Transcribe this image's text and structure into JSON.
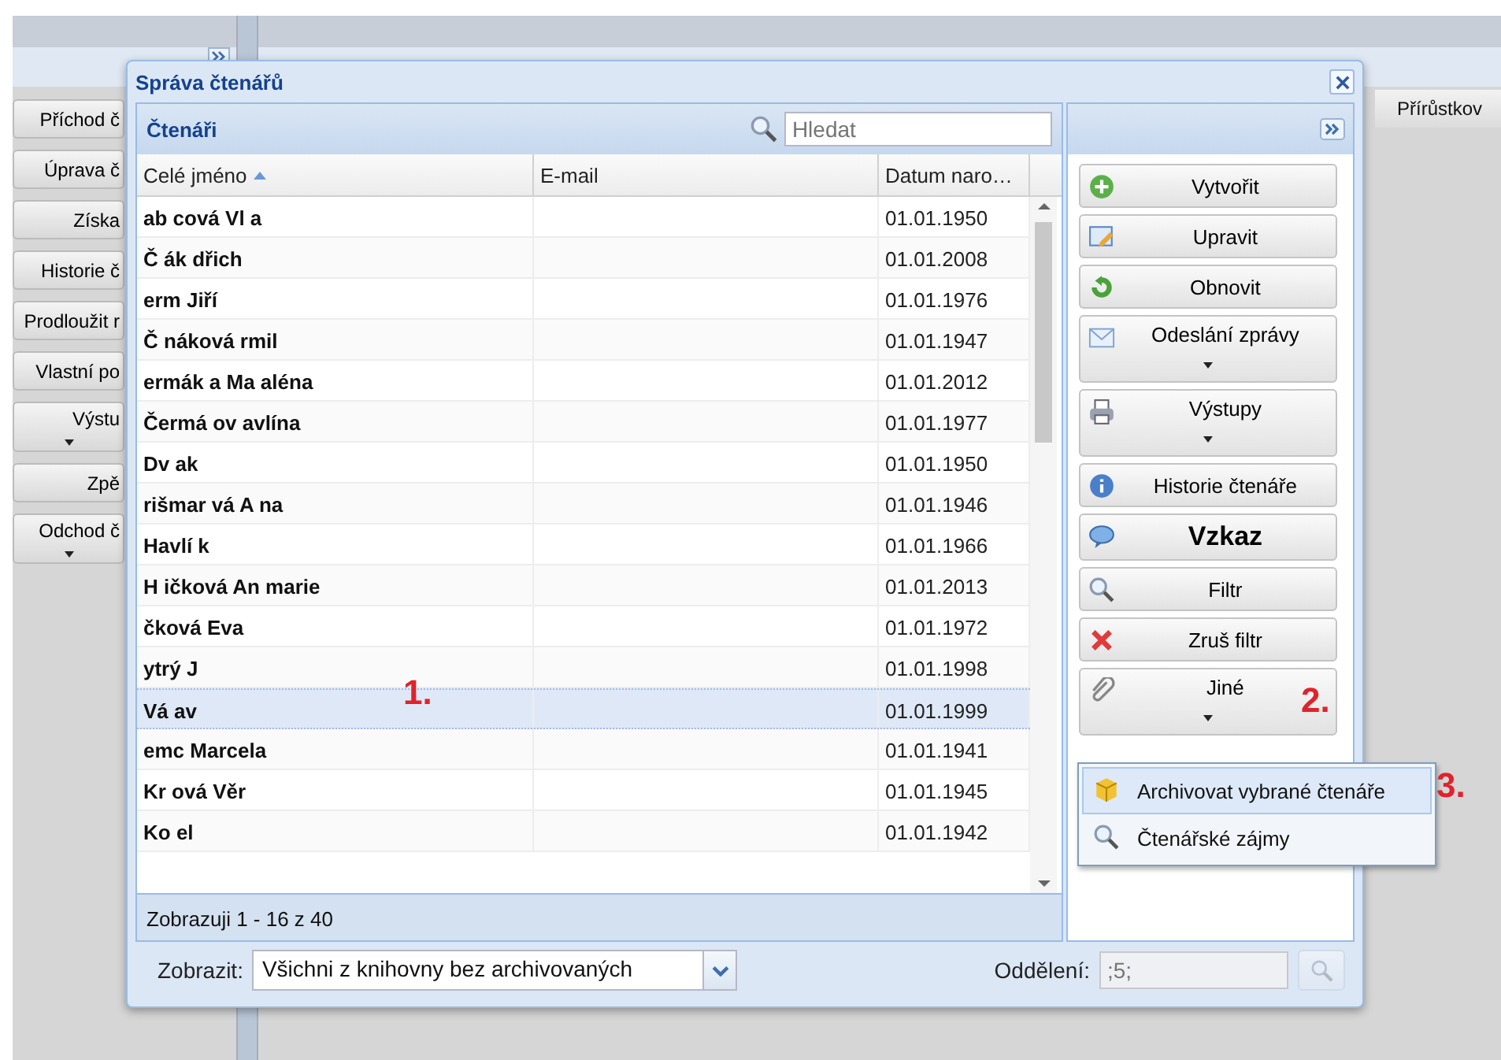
{
  "app": {
    "right_header": "Přírůstkov",
    "sidebar_buttons": [
      {
        "label": "Příchod č",
        "dropdown": false
      },
      {
        "label": "Úprava č",
        "dropdown": false
      },
      {
        "label": "Získa",
        "dropdown": false
      },
      {
        "label": "Historie č",
        "dropdown": false
      },
      {
        "label": "Prodloužit r",
        "dropdown": false
      },
      {
        "label": "Vlastní po",
        "dropdown": false
      },
      {
        "label": "Výstu",
        "dropdown": true
      },
      {
        "label": "Zpě",
        "dropdown": false
      },
      {
        "label": "Odchod č",
        "dropdown": true
      }
    ]
  },
  "dialog": {
    "title": "Správa čtenářů",
    "grid": {
      "title": "Čtenáři",
      "search": {
        "placeholder": "Hledat"
      },
      "columns": [
        {
          "label": "Celé jméno",
          "sorted": true
        },
        {
          "label": "E-mail",
          "sorted": false
        },
        {
          "label": "Datum naro…",
          "sorted": false
        }
      ],
      "rows": [
        {
          "name": "ab cová Vl a",
          "birth": "01.01.1950",
          "selected": false
        },
        {
          "name": "Č ák dřich",
          "birth": "01.01.2008",
          "selected": false
        },
        {
          "name": "erm Jiří",
          "birth": "01.01.1976",
          "selected": false
        },
        {
          "name": "Č náková rmil",
          "birth": "01.01.1947",
          "selected": false
        },
        {
          "name": "ermák a Ma aléna",
          "birth": "01.01.2012",
          "selected": false
        },
        {
          "name": "Čermá ov avlína",
          "birth": "01.01.1977",
          "selected": false
        },
        {
          "name": "Dv ak",
          "birth": "01.01.1950",
          "selected": false
        },
        {
          "name": "rišmar vá A na",
          "birth": "01.01.1946",
          "selected": false
        },
        {
          "name": "Havlí k",
          "birth": "01.01.1966",
          "selected": false
        },
        {
          "name": "H ičková An marie",
          "birth": "01.01.2013",
          "selected": false
        },
        {
          "name": "čková Eva",
          "birth": "01.01.1972",
          "selected": false
        },
        {
          "name": "ytrý J",
          "birth": "01.01.1998",
          "selected": false
        },
        {
          "name": "Vá av",
          "birth": "01.01.1999",
          "selected": true
        },
        {
          "name": "emc Marcela",
          "birth": "01.01.1941",
          "selected": false
        },
        {
          "name": "Kr ová Věr",
          "birth": "01.01.1945",
          "selected": false
        },
        {
          "name": "Ko el",
          "birth": "01.01.1942",
          "selected": false
        }
      ],
      "paging": "Zobrazuji 1 - 16 z 40"
    },
    "actions": [
      {
        "label": "Vytvořit",
        "dropdown": false,
        "emphasized": false
      },
      {
        "label": "Upravit",
        "dropdown": false,
        "emphasized": false
      },
      {
        "label": "Obnovit",
        "dropdown": false,
        "emphasized": false
      },
      {
        "label": "Odeslání zprávy",
        "dropdown": true,
        "emphasized": false
      },
      {
        "label": "Výstupy",
        "dropdown": true,
        "emphasized": false
      },
      {
        "label": "Historie čtenáře",
        "dropdown": false,
        "emphasized": false
      },
      {
        "label": "Vzkaz",
        "dropdown": false,
        "emphasized": true
      },
      {
        "label": "Filtr",
        "dropdown": false,
        "emphasized": false
      },
      {
        "label": "Zruš filtr",
        "dropdown": false,
        "emphasized": false
      },
      {
        "label": "Jiné",
        "dropdown": true,
        "emphasized": false
      }
    ],
    "menu": [
      {
        "label": "Archivovat vybrané čtenáře",
        "selected": true
      },
      {
        "label": "Čtenářské zájmy",
        "selected": false
      }
    ],
    "filter": {
      "label": "Zobrazit:",
      "value": "Všichni z knihovny bez archivovaných"
    },
    "department": {
      "label": "Oddělení:",
      "placeholder": ";5;",
      "disabled": true
    }
  },
  "annotations": [
    "1.",
    "2.",
    "3."
  ]
}
